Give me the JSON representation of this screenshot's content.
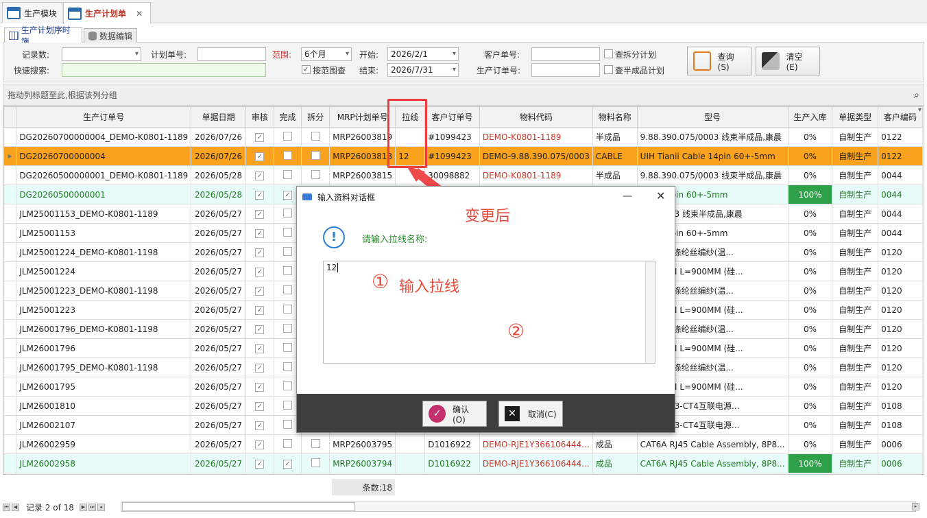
{
  "tabs": [
    {
      "label": "生产模块"
    },
    {
      "label": "生产计划单"
    }
  ],
  "subtabs": [
    {
      "label": "生产计划序时簿"
    },
    {
      "label": "数据编辑"
    }
  ],
  "filter": {
    "record_count_label": "记录数:",
    "record_count_value": "",
    "plan_no_label": "计划单号:",
    "plan_no_value": "",
    "range_label": "范围:",
    "range_value": "6个月",
    "by_range_label": "按范围查",
    "start_label": "开始:",
    "start_value": "2026/2/1",
    "end_label": "结束:",
    "end_value": "2026/7/31",
    "cust_no_label": "客户单号:",
    "cust_no_value": "",
    "prod_order_label": "生产订单号:",
    "prod_order_value": "",
    "check_split_label": "查拆分计划",
    "check_semi_label": "查半成品计划",
    "quick_search_label": "快速搜索:",
    "quick_search_value": "",
    "query_label": "查询(S)",
    "clear_label": "清空(E)"
  },
  "group_bar": {
    "text": "拖动列标题至此,根据该列分组"
  },
  "grid": {
    "columns": [
      "生产订单号",
      "单据日期",
      "审核",
      "完成",
      "拆分",
      "MRP计划单号",
      "拉线",
      "客户订单号",
      "物料代码",
      "物料名称",
      "型号",
      "生产入库",
      "单据类型",
      "客户编码"
    ],
    "rows": [
      {
        "order": "DG20260700000004_DEMO-K0801-1189",
        "date": "2026/07/26",
        "audit": "✓",
        "done": "",
        "split": "",
        "mrp": "MRP26003819",
        "line": "",
        "cust": "#1099423",
        "mat": "DEMO-K0801-1189",
        "name": "半成品",
        "model": "9.88.390.075/0003 线束半成品,康晨",
        "pct": "0%",
        "type": "自制生产",
        "code": "0122"
      },
      {
        "order": "DG20260700000004",
        "date": "2026/07/26",
        "audit": "✓",
        "done": "",
        "split": "",
        "mrp": "MRP26003818",
        "line": "12",
        "cust": "#1099423",
        "mat": "DEMO-9.88.390.075/0003",
        "name": "CABLE",
        "model": "UIH Tianii Cable 14pin 60+-5mm",
        "pct": "0%",
        "type": "自制生产",
        "code": "0122"
      },
      {
        "order": "DG20260500000001_DEMO-K0801-1189",
        "date": "2026/05/28",
        "audit": "✓",
        "done": "",
        "split": "",
        "mrp": "MRP26003815",
        "line": "",
        "cust": "30098882",
        "mat": "DEMO-K0801-1189",
        "name": "半成品",
        "model": "9.88.390.075/0003 线束半成品,康晨",
        "pct": "0%",
        "type": "自制生产",
        "code": "0044"
      },
      {
        "order": "DG20260500000001",
        "date": "2026/05/28",
        "audit": "✓",
        "done": "✓",
        "split": "",
        "mrp": "",
        "line": "",
        "cust": "",
        "mat": "",
        "name": "",
        "model": "able 14pin 60+-5mm",
        "pct": "100%",
        "type": "自制生产",
        "code": "0044"
      },
      {
        "order": "JLM25001153_DEMO-K0801-1189",
        "date": "2026/05/27",
        "audit": "✓",
        "done": "",
        "split": "",
        "mrp": "",
        "line": "",
        "cust": "",
        "mat": "",
        "name": "",
        "model": "075/0003 线束半成品,康晨",
        "pct": "0%",
        "type": "自制生产",
        "code": "0044"
      },
      {
        "order": "JLM25001153",
        "date": "2026/05/27",
        "audit": "✓",
        "done": "",
        "split": "",
        "mrp": "",
        "line": "",
        "cust": "",
        "mat": "",
        "name": "",
        "model": "able 14pin 60+-5mm",
        "pct": "0%",
        "type": "自制生产",
        "code": "0044"
      },
      {
        "order": "JLM25001224_DEMO-K0801-1198",
        "date": "2026/05/27",
        "audit": "✓",
        "done": "",
        "split": "",
        "mrp": "",
        "line": "",
        "cust": "",
        "mat": "",
        "name": "",
        "model": "编浅绿色涤纶丝编纱(温...",
        "pct": "0%",
        "type": "自制生产",
        "code": "0120"
      },
      {
        "order": "JLM25001224",
        "date": "2026/05/27",
        "audit": "✓",
        "done": "",
        "split": "",
        "mrp": "",
        "line": "",
        "cust": "",
        "mat": "",
        "name": "",
        "model": "TO OPEN L=900MM (硅...",
        "pct": "0%",
        "type": "自制生产",
        "code": "0120"
      },
      {
        "order": "JLM25001223_DEMO-K0801-1198",
        "date": "2026/05/27",
        "audit": "✓",
        "done": "",
        "split": "",
        "mrp": "",
        "line": "",
        "cust": "",
        "mat": "",
        "name": "",
        "model": "编浅绿色涤纶丝编纱(温...",
        "pct": "0%",
        "type": "自制生产",
        "code": "0120"
      },
      {
        "order": "JLM25001223",
        "date": "2026/05/27",
        "audit": "✓",
        "done": "",
        "split": "",
        "mrp": "",
        "line": "",
        "cust": "",
        "mat": "",
        "name": "",
        "model": "TO OPEN L=900MM (硅...",
        "pct": "0%",
        "type": "自制生产",
        "code": "0120"
      },
      {
        "order": "JLM26001796_DEMO-K0801-1198",
        "date": "2026/05/27",
        "audit": "✓",
        "done": "",
        "split": "",
        "mrp": "",
        "line": "",
        "cust": "",
        "mat": "",
        "name": "",
        "model": "编浅绿色涤纶丝编纱(温...",
        "pct": "0%",
        "type": "自制生产",
        "code": "0120"
      },
      {
        "order": "JLM26001796",
        "date": "2026/05/27",
        "audit": "✓",
        "done": "",
        "split": "",
        "mrp": "",
        "line": "",
        "cust": "",
        "mat": "",
        "name": "",
        "model": "TO OPEN L=900MM (硅...",
        "pct": "0%",
        "type": "自制生产",
        "code": "0120"
      },
      {
        "order": "JLM26001795_DEMO-K0801-1198",
        "date": "2026/05/27",
        "audit": "✓",
        "done": "",
        "split": "",
        "mrp": "",
        "line": "",
        "cust": "",
        "mat": "",
        "name": "",
        "model": "编浅绿色涤纶丝编纱(温...",
        "pct": "0%",
        "type": "自制生产",
        "code": "0120"
      },
      {
        "order": "JLM26001795",
        "date": "2026/05/27",
        "audit": "✓",
        "done": "",
        "split": "",
        "mrp": "",
        "line": "",
        "cust": "",
        "mat": "",
        "name": "",
        "model": "TO OPEN L=900MM (硅...",
        "pct": "0%",
        "type": "自制生产",
        "code": "0120"
      },
      {
        "order": "JLM26001810",
        "date": "2026/05/27",
        "audit": "✓",
        "done": "",
        "split": "",
        "mrp": "",
        "line": "",
        "cust": "",
        "mat": "",
        "name": "",
        "model": "4768 CT3-CT4互联电源...",
        "pct": "0%",
        "type": "自制生产",
        "code": "0108"
      },
      {
        "order": "JLM26002107",
        "date": "2026/05/27",
        "audit": "✓",
        "done": "",
        "split": "",
        "mrp": "",
        "line": "",
        "cust": "",
        "mat": "",
        "name": "",
        "model": "4768 CT3-CT4互联电源...",
        "pct": "0%",
        "type": "自制生产",
        "code": "0108"
      },
      {
        "order": "JLM26002959",
        "date": "2026/05/27",
        "audit": "✓",
        "done": "",
        "split": "",
        "mrp": "MRP26003795",
        "line": "",
        "cust": "D1016922",
        "mat": "DEMO-RJE1Y366106444...",
        "name": "成品",
        "model": "CAT6A RJ45 Cable Assembly, 8P8...",
        "pct": "0%",
        "type": "自制生产",
        "code": "0006"
      },
      {
        "order": "JLM26002958",
        "date": "2026/05/27",
        "audit": "✓",
        "done": "✓",
        "split": "",
        "mrp": "MRP26003794",
        "line": "",
        "cust": "D1016922",
        "mat": "DEMO-RJE1Y366106444...",
        "name": "成品",
        "model": "CAT6A RJ45 Cable Assembly, 8P8...",
        "pct": "100%",
        "type": "自制生产",
        "code": "0006"
      }
    ],
    "footer_count": "条数:18"
  },
  "navigator": {
    "record_text": "记录 2 of 18"
  },
  "dialog": {
    "title": "输入资料对话框",
    "prompt": "请输入拉线名称:",
    "input_value": "12",
    "ok_label": "确认(O)",
    "cancel_label": "取消(C)"
  },
  "annotations": {
    "after_change": "变更后",
    "step1_num": "①",
    "step1": "输入拉线",
    "step2_num": "②"
  },
  "colors": {
    "selected_row": "#f9a21d",
    "completed_row": "#e8fbfb",
    "progress_full": "#2fa04a",
    "annotation": "#e74c3c"
  }
}
